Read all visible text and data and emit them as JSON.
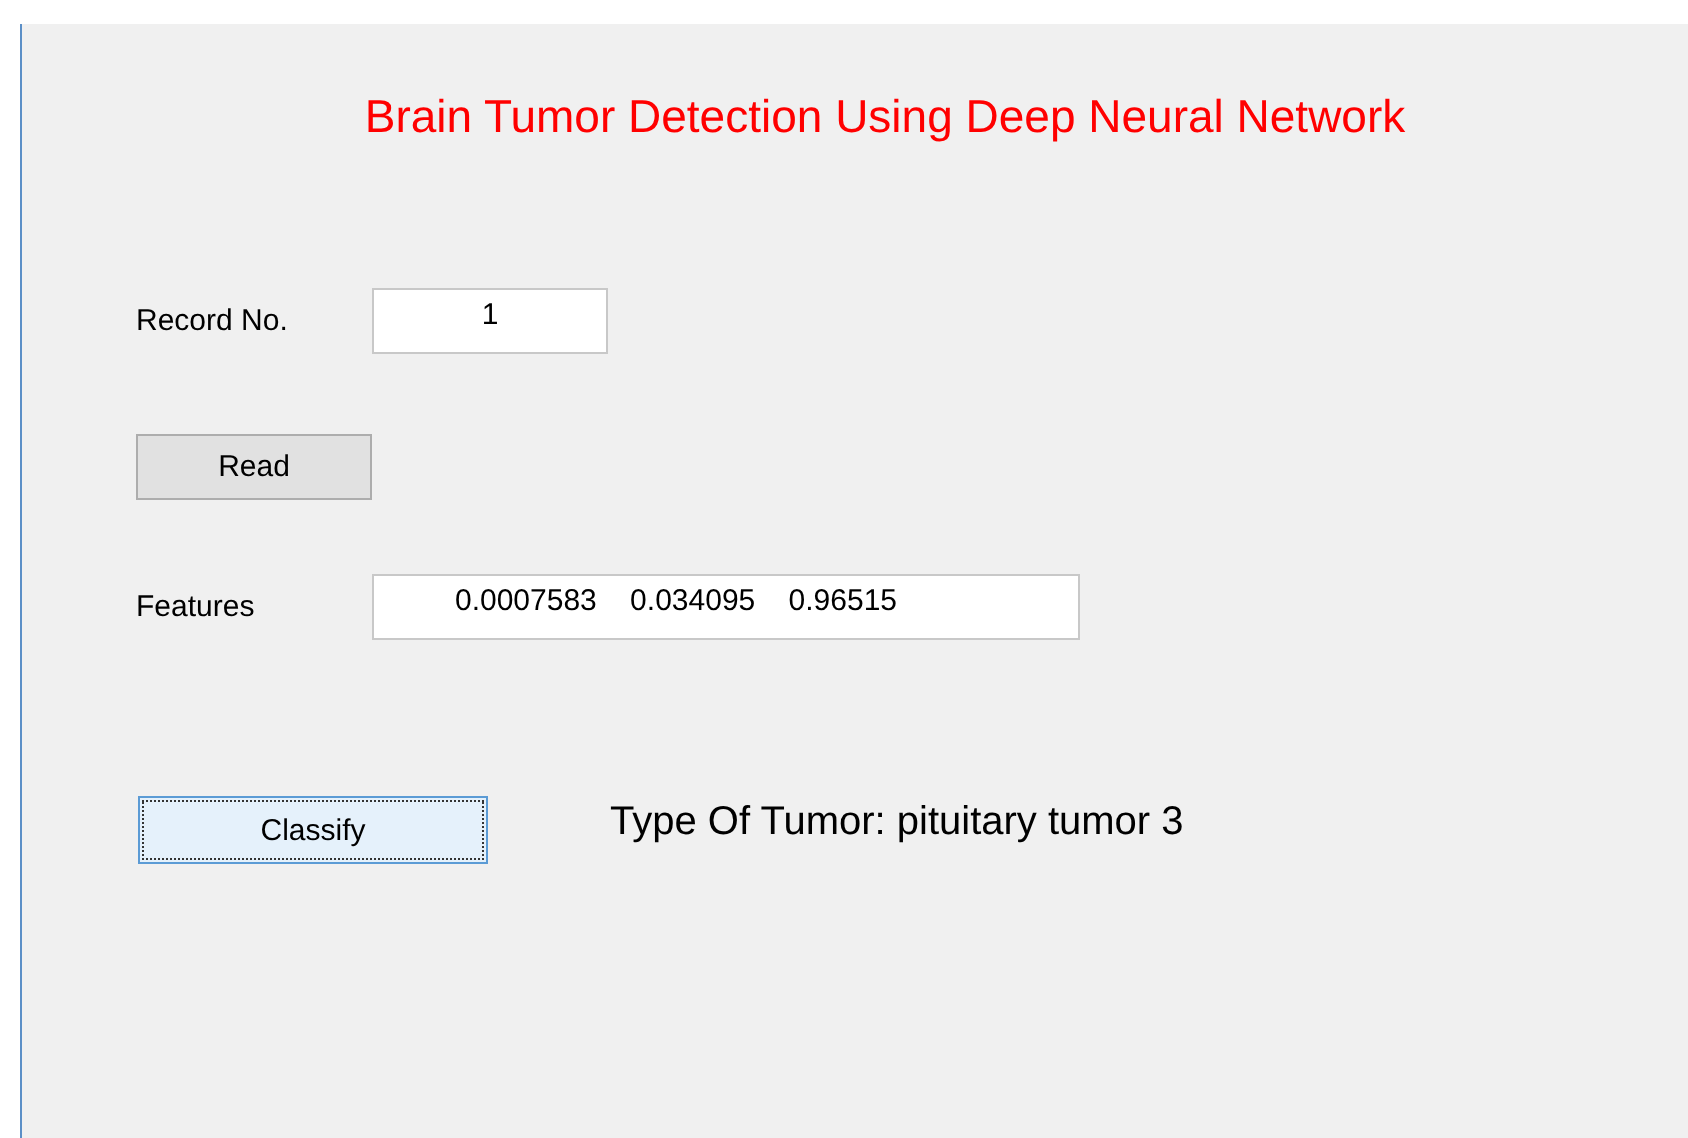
{
  "title": "Brain Tumor Detection Using Deep Neural Network",
  "record": {
    "label": "Record No.",
    "value": "1"
  },
  "read_button": {
    "label": "Read",
    "focused": false
  },
  "features": {
    "label": "Features",
    "value": "0.0007583    0.034095    0.96515"
  },
  "classify_button": {
    "label": "Classify",
    "focused": true
  },
  "result": "Type Of Tumor: pituitary tumor 3"
}
